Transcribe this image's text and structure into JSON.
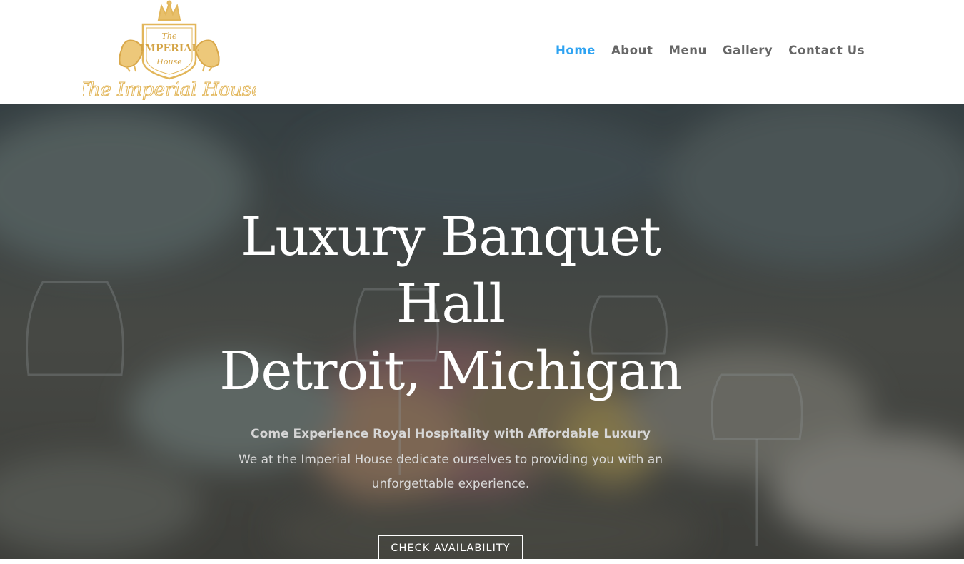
{
  "brand": {
    "logo_name": "The Imperial House",
    "logo_text_top": "The",
    "logo_text_middle": "IMPERIAL",
    "logo_text_bottom": "House",
    "logo_script": "The Imperial House",
    "gold": "#e2b65a"
  },
  "nav": {
    "items": [
      {
        "label": "Home",
        "active": true
      },
      {
        "label": "About",
        "active": false
      },
      {
        "label": "Menu",
        "active": false
      },
      {
        "label": "Gallery",
        "active": false
      },
      {
        "label": "Contact Us",
        "active": false
      }
    ],
    "active_color": "#2ea3f2",
    "text_color": "#666666"
  },
  "hero": {
    "title_line1": "Luxury Banquet Hall",
    "title_line2": "Detroit, Michigan",
    "tagline": "Come Experience Royal Hospitality with Affordable Luxury",
    "description_line1": "We at the Imperial House dedicate ourselves to providing you with an",
    "description_line2": "unforgettable experience.",
    "cta_label": "CHECK AVAILABILITY"
  }
}
